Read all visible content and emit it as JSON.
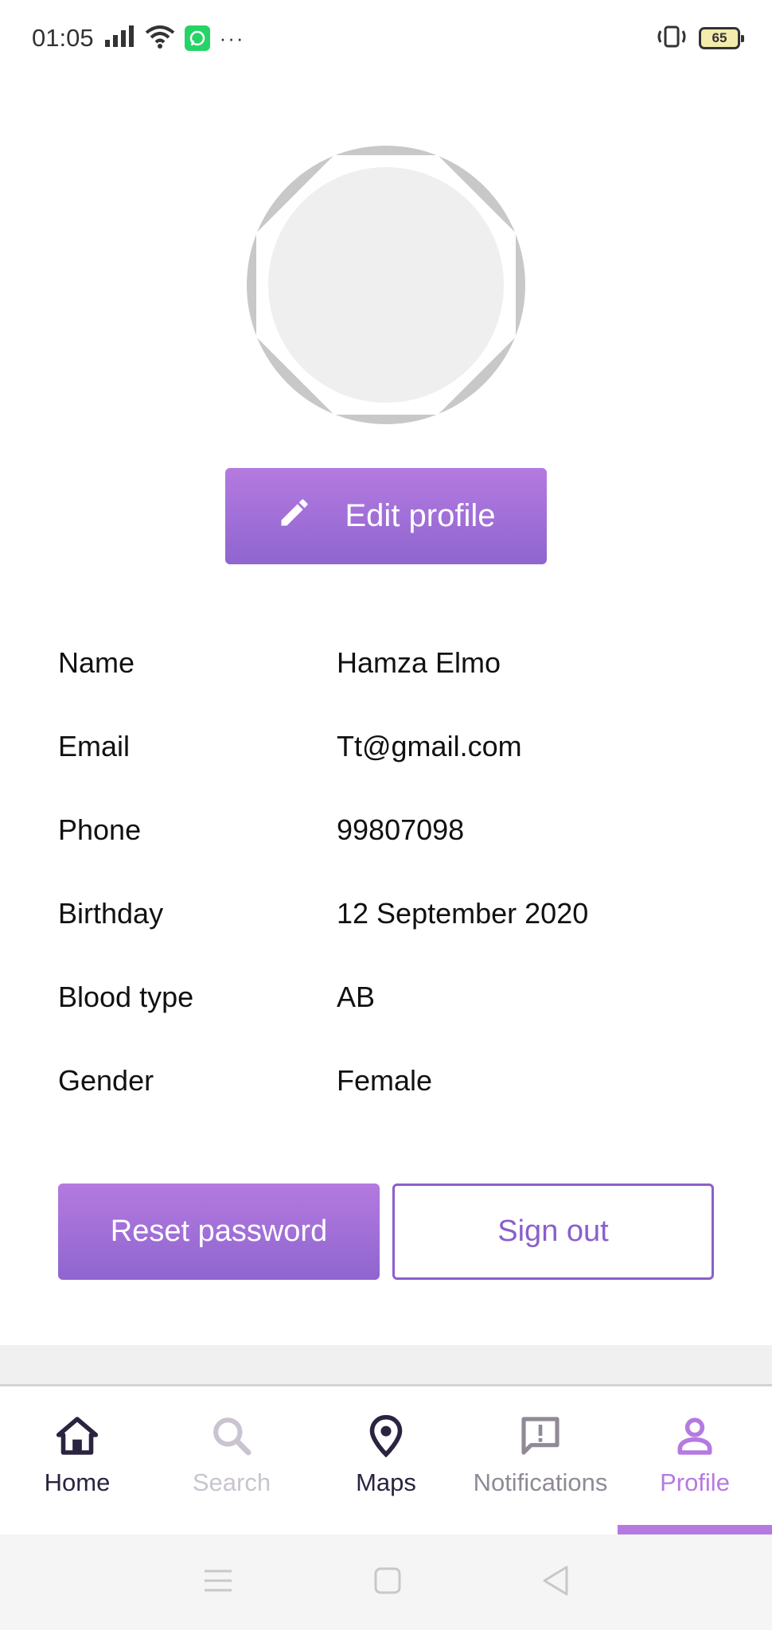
{
  "status_bar": {
    "time": "01:05",
    "battery": "65",
    "icons": [
      "signal-icon",
      "wifi-icon",
      "whatsapp-icon",
      "more-dots-icon",
      "vibrate-icon",
      "battery-icon"
    ]
  },
  "profile": {
    "edit_label": "Edit profile",
    "fields": [
      {
        "label": "Name",
        "value": "Hamza Elmo"
      },
      {
        "label": "Email",
        "value": "Tt@gmail.com"
      },
      {
        "label": "Phone",
        "value": "99807098"
      },
      {
        "label": "Birthday",
        "value": "12 September 2020"
      },
      {
        "label": "Blood type",
        "value": "AB"
      },
      {
        "label": "Gender",
        "value": "Female"
      }
    ],
    "reset_label": "Reset password",
    "signout_label": "Sign out"
  },
  "nav": {
    "items": [
      {
        "label": "Home",
        "icon": "home-icon",
        "color": "#2b2340"
      },
      {
        "label": "Search",
        "icon": "search-icon",
        "color": "#c9c4cf"
      },
      {
        "label": "Maps",
        "icon": "map-pin-icon",
        "color": "#2b2340"
      },
      {
        "label": "Notifications",
        "icon": "notifications-icon",
        "color": "#8f8a96"
      },
      {
        "label": "Profile",
        "icon": "profile-icon",
        "color": "#b57ae0"
      }
    ],
    "active": "Profile"
  },
  "colors": {
    "accent": "#b57ae0",
    "accent_dark": "#8f65cf",
    "outline": "#8a5fcc"
  }
}
